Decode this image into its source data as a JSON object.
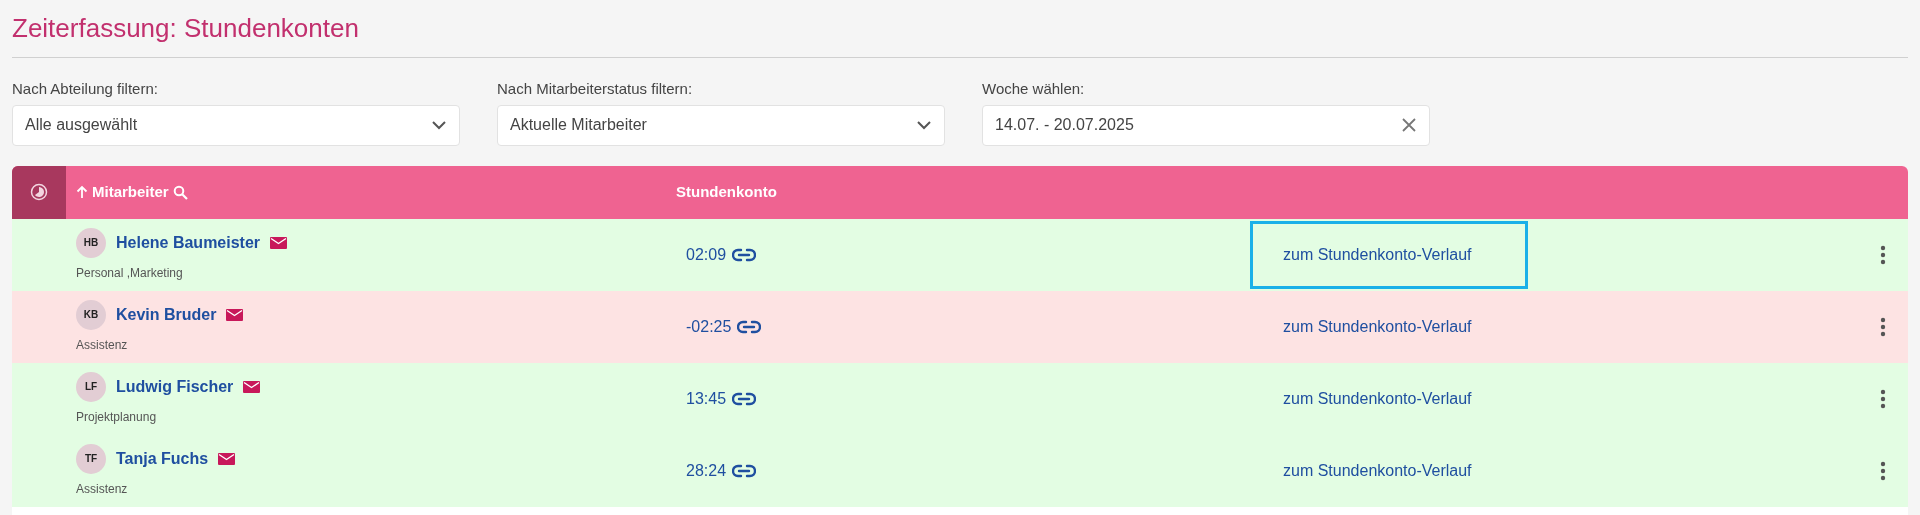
{
  "title": "Zeiterfassung: Stundenkonten",
  "filters": [
    {
      "label": "Nach Abteilung filtern:",
      "value": "Alle ausgewählt",
      "kind": "select"
    },
    {
      "label": "Nach Mitarbeiterstatus filtern:",
      "value": "Aktuelle Mitarbeiter",
      "kind": "select"
    },
    {
      "label": "Woche wählen:",
      "value": "14.07. - 20.07.2025",
      "kind": "clearable"
    }
  ],
  "table": {
    "columns": [
      {
        "label": "Mitarbeiter",
        "sortable": true,
        "searchable": true
      },
      {
        "label": "Stundenkonto",
        "sortable": false,
        "searchable": false
      }
    ],
    "rows": [
      {
        "initials": "HB",
        "name": "Helene Baumeister",
        "department": "Personal ,Marketing",
        "balance": "02:09",
        "kind": "positive",
        "link": "zum Stundenkonto-Verlauf",
        "focused": true
      },
      {
        "initials": "KB",
        "name": "Kevin Bruder",
        "department": "Assistenz",
        "balance": "-02:25",
        "kind": "negative",
        "link": "zum Stundenkonto-Verlauf",
        "focused": false
      },
      {
        "initials": "LF",
        "name": "Ludwig Fischer",
        "department": "Projektplanung",
        "balance": "13:45",
        "kind": "positive",
        "link": "zum Stundenkonto-Verlauf",
        "focused": false
      },
      {
        "initials": "TF",
        "name": "Tanja Fuchs",
        "department": "Assistenz",
        "balance": "28:24",
        "kind": "positive",
        "link": "zum Stundenkonto-Verlauf",
        "focused": false
      }
    ]
  }
}
